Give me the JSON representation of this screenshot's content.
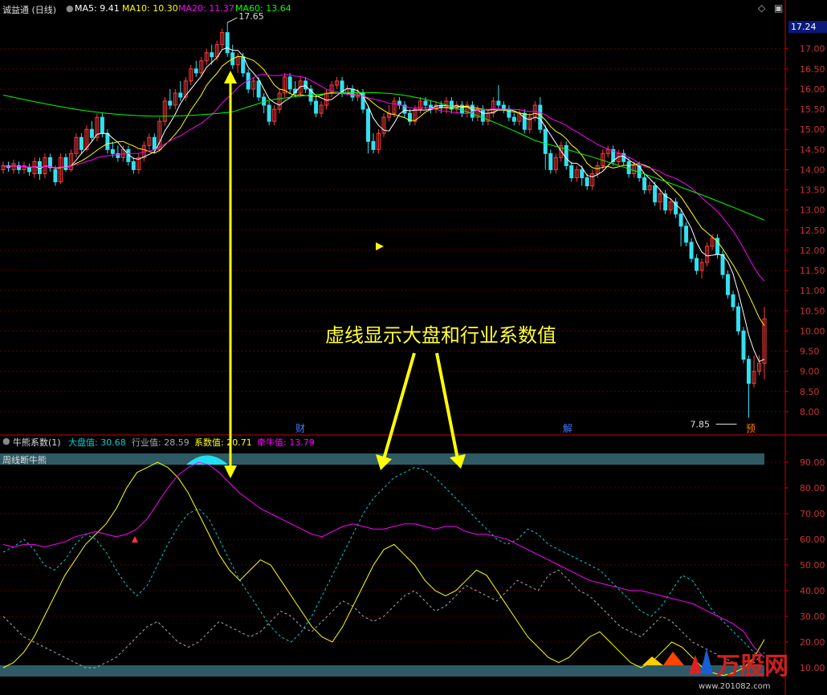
{
  "upper": {
    "stock_name": "诚益通 (日线)",
    "ma_legend": [
      {
        "label": "MA5: 9.41",
        "color": "#ffffff"
      },
      {
        "label": "MA10: 10.30",
        "color": "#ffff00"
      },
      {
        "label": "MA20: 11.37",
        "color": "#ff00ff"
      },
      {
        "label": "MA60: 13.64",
        "color": "#00ff00"
      }
    ],
    "current_price": "17.24",
    "high_label": "17.65",
    "low_label": "7.85",
    "event_markers": [
      "财",
      "解",
      "预"
    ]
  },
  "lower": {
    "indicator_name": "牛熊系数(1)",
    "legend": [
      {
        "label": "大盘值: 30.68",
        "color": "#00ced1"
      },
      {
        "label": "行业值: 28.59",
        "color": "#aaaaaa"
      },
      {
        "label": "系数值: 20.71",
        "color": "#ffff00"
      },
      {
        "label": "牵牛值: 13.79",
        "color": "#ff00ff"
      }
    ],
    "band_label": "周线断牛熊"
  },
  "annotation": "虚线显示大盘和行业系数值",
  "watermark": "万股网",
  "watermark_url": "www.201082.com",
  "chart_data": [
    {
      "type": "candlestick",
      "title": "诚益通 (日线)",
      "y_ticks": [
        "17.00",
        "16.50",
        "16.00",
        "15.50",
        "15.00",
        "14.50",
        "14.00",
        "13.50",
        "13.00",
        "12.50",
        "12.00",
        "11.50",
        "11.00",
        "10.50",
        "10.00",
        "9.50",
        "9.00",
        "8.50",
        "8.00"
      ],
      "ylim": [
        7.7,
        17.85
      ],
      "grid": true,
      "annotations": {
        "high": 17.65,
        "low": 7.85
      },
      "series": [
        {
          "name": "MA5",
          "color": "#ffffff"
        },
        {
          "name": "MA10",
          "color": "#ffff00"
        },
        {
          "name": "MA20",
          "color": "#ff00ff"
        },
        {
          "name": "MA60",
          "color": "#00ff00"
        }
      ],
      "candles": [
        [
          14.0,
          14.1,
          13.9,
          14.2
        ],
        [
          14.1,
          14.05,
          13.95,
          14.2
        ],
        [
          14.0,
          14.15,
          13.9,
          14.25
        ],
        [
          14.1,
          14.0,
          13.9,
          14.2
        ],
        [
          14.0,
          14.1,
          13.9,
          14.2
        ],
        [
          14.05,
          13.95,
          13.85,
          14.15
        ],
        [
          13.9,
          14.2,
          13.8,
          14.3
        ],
        [
          14.2,
          13.9,
          13.75,
          14.3
        ],
        [
          13.9,
          14.3,
          13.8,
          14.4
        ],
        [
          14.3,
          14.05,
          13.95,
          14.4
        ],
        [
          14.0,
          13.7,
          13.6,
          14.1
        ],
        [
          13.7,
          14.3,
          13.65,
          14.4
        ],
        [
          14.3,
          14.0,
          13.95,
          14.4
        ],
        [
          14.0,
          14.4,
          13.95,
          14.5
        ],
        [
          14.4,
          14.8,
          14.3,
          14.9
        ],
        [
          14.8,
          14.5,
          14.4,
          14.9
        ],
        [
          14.5,
          15.0,
          14.45,
          15.1
        ],
        [
          15.0,
          14.8,
          14.7,
          15.2
        ],
        [
          14.8,
          15.3,
          14.7,
          15.4
        ],
        [
          15.3,
          14.9,
          14.8,
          15.4
        ],
        [
          14.9,
          14.5,
          14.4,
          15.0
        ],
        [
          14.5,
          14.4,
          14.3,
          14.7
        ],
        [
          14.4,
          14.3,
          14.2,
          14.6
        ],
        [
          14.3,
          14.5,
          14.2,
          14.6
        ],
        [
          14.5,
          14.2,
          14.1,
          14.6
        ],
        [
          14.2,
          14.0,
          13.9,
          14.3
        ],
        [
          14.0,
          14.3,
          13.9,
          14.4
        ],
        [
          14.3,
          14.6,
          14.2,
          14.7
        ],
        [
          14.6,
          14.8,
          14.5,
          14.9
        ],
        [
          14.8,
          14.5,
          14.4,
          14.9
        ],
        [
          14.5,
          15.2,
          14.45,
          15.3
        ],
        [
          15.2,
          15.7,
          15.1,
          15.8
        ],
        [
          15.7,
          15.6,
          15.5,
          16.0
        ],
        [
          15.6,
          15.9,
          15.5,
          16.0
        ],
        [
          15.9,
          15.8,
          15.7,
          16.2
        ],
        [
          15.8,
          16.2,
          15.7,
          16.3
        ],
        [
          16.2,
          16.5,
          16.1,
          16.6
        ],
        [
          16.5,
          16.4,
          16.3,
          16.7
        ],
        [
          16.4,
          16.7,
          16.3,
          16.8
        ],
        [
          16.7,
          16.9,
          16.6,
          17.0
        ],
        [
          16.9,
          16.8,
          16.6,
          17.1
        ],
        [
          16.8,
          17.1,
          16.7,
          17.2
        ],
        [
          17.1,
          17.4,
          17.0,
          17.5
        ],
        [
          17.4,
          16.9,
          16.8,
          17.65
        ],
        [
          16.9,
          16.6,
          16.5,
          17.1
        ],
        [
          16.6,
          16.8,
          16.4,
          16.9
        ],
        [
          16.8,
          16.4,
          16.3,
          16.9
        ],
        [
          16.4,
          16.0,
          15.9,
          16.5
        ],
        [
          16.0,
          16.2,
          15.8,
          16.3
        ],
        [
          16.2,
          15.8,
          15.7,
          16.3
        ],
        [
          15.8,
          15.6,
          15.4,
          15.9
        ],
        [
          15.6,
          15.2,
          15.1,
          15.7
        ],
        [
          15.2,
          15.5,
          15.1,
          15.6
        ],
        [
          15.5,
          15.9,
          15.4,
          16.0
        ],
        [
          15.9,
          16.3,
          15.8,
          16.4
        ],
        [
          16.3,
          16.0,
          15.9,
          16.4
        ],
        [
          16.0,
          15.9,
          15.8,
          16.2
        ],
        [
          15.9,
          16.2,
          15.8,
          16.3
        ],
        [
          16.2,
          16.0,
          15.9,
          16.3
        ],
        [
          16.0,
          15.7,
          15.6,
          16.1
        ],
        [
          15.7,
          15.4,
          15.3,
          15.8
        ],
        [
          15.4,
          15.6,
          15.3,
          15.7
        ],
        [
          15.6,
          15.9,
          15.5,
          16.0
        ],
        [
          15.9,
          16.1,
          15.8,
          16.2
        ],
        [
          16.1,
          16.2,
          16.0,
          16.3
        ],
        [
          16.2,
          15.9,
          15.8,
          16.3
        ],
        [
          15.9,
          16.0,
          15.85,
          16.1
        ],
        [
          16.0,
          15.8,
          15.7,
          16.1
        ],
        [
          15.8,
          15.9,
          15.7,
          16.0
        ],
        [
          15.9,
          15.5,
          15.4,
          16.0
        ],
        [
          15.5,
          14.7,
          14.4,
          15.6
        ],
        [
          14.7,
          14.5,
          14.4,
          14.9
        ],
        [
          14.5,
          14.9,
          14.4,
          15.0
        ],
        [
          14.9,
          15.3,
          14.8,
          15.4
        ],
        [
          15.3,
          15.4,
          15.2,
          15.6
        ],
        [
          15.4,
          15.7,
          15.3,
          15.8
        ],
        [
          15.7,
          15.6,
          15.5,
          15.8
        ],
        [
          15.6,
          15.4,
          15.3,
          15.7
        ],
        [
          15.4,
          15.2,
          15.1,
          15.5
        ],
        [
          15.2,
          15.5,
          15.1,
          15.6
        ],
        [
          15.5,
          15.7,
          15.4,
          15.8
        ],
        [
          15.7,
          15.6,
          15.5,
          15.8
        ],
        [
          15.6,
          15.5,
          15.4,
          15.7
        ],
        [
          15.5,
          15.6,
          15.4,
          15.7
        ],
        [
          15.6,
          15.55,
          15.4,
          15.7
        ],
        [
          15.55,
          15.7,
          15.4,
          15.8
        ],
        [
          15.7,
          15.5,
          15.4,
          15.8
        ],
        [
          15.5,
          15.6,
          15.4,
          15.7
        ],
        [
          15.6,
          15.4,
          15.3,
          15.7
        ],
        [
          15.4,
          15.6,
          15.3,
          15.7
        ],
        [
          15.6,
          15.3,
          15.2,
          15.7
        ],
        [
          15.3,
          15.5,
          15.2,
          15.6
        ],
        [
          15.5,
          15.2,
          15.1,
          15.6
        ],
        [
          15.2,
          15.4,
          15.1,
          15.5
        ],
        [
          15.4,
          15.7,
          15.3,
          15.8
        ],
        [
          15.7,
          15.6,
          15.5,
          16.1
        ],
        [
          15.6,
          15.5,
          15.4,
          15.7
        ],
        [
          15.5,
          15.3,
          15.2,
          15.6
        ],
        [
          15.3,
          15.2,
          15.1,
          15.4
        ],
        [
          15.2,
          15.4,
          15.1,
          15.5
        ],
        [
          15.4,
          15.0,
          14.9,
          15.5
        ],
        [
          15.0,
          15.3,
          14.9,
          15.4
        ],
        [
          15.3,
          15.6,
          15.2,
          15.7
        ],
        [
          15.6,
          15.0,
          14.9,
          15.8
        ],
        [
          15.0,
          14.4,
          14.0,
          15.1
        ],
        [
          14.4,
          14.0,
          13.9,
          14.5
        ],
        [
          14.0,
          14.3,
          13.9,
          14.4
        ],
        [
          14.3,
          14.6,
          14.2,
          14.7
        ],
        [
          14.6,
          14.1,
          14.0,
          14.7
        ],
        [
          14.1,
          13.8,
          13.7,
          14.2
        ],
        [
          13.8,
          14.0,
          13.7,
          14.1
        ],
        [
          14.0,
          13.8,
          13.6,
          14.1
        ],
        [
          13.8,
          13.6,
          13.5,
          13.9
        ],
        [
          13.6,
          13.9,
          13.5,
          14.0
        ],
        [
          13.9,
          14.1,
          13.8,
          14.2
        ],
        [
          14.1,
          14.4,
          14.0,
          14.5
        ],
        [
          14.4,
          14.5,
          14.3,
          14.6
        ],
        [
          14.5,
          14.2,
          14.1,
          14.6
        ],
        [
          14.2,
          14.4,
          14.1,
          14.5
        ],
        [
          14.4,
          14.2,
          14.1,
          14.5
        ],
        [
          14.2,
          13.9,
          13.8,
          14.3
        ],
        [
          13.9,
          14.1,
          13.8,
          14.2
        ],
        [
          14.1,
          13.8,
          13.7,
          14.2
        ],
        [
          13.8,
          13.5,
          13.4,
          13.9
        ],
        [
          13.5,
          13.6,
          13.4,
          13.7
        ],
        [
          13.6,
          13.2,
          13.1,
          13.7
        ],
        [
          13.2,
          13.4,
          13.0,
          13.5
        ],
        [
          13.4,
          13.0,
          12.9,
          13.5
        ],
        [
          13.0,
          13.2,
          12.9,
          13.3
        ],
        [
          13.2,
          12.9,
          12.8,
          13.3
        ],
        [
          12.9,
          12.6,
          12.1,
          13.0
        ],
        [
          12.6,
          12.2,
          12.1,
          12.7
        ],
        [
          12.2,
          11.8,
          11.7,
          12.3
        ],
        [
          11.8,
          11.5,
          11.4,
          11.9
        ],
        [
          11.5,
          11.7,
          11.3,
          11.8
        ],
        [
          11.7,
          12.1,
          11.6,
          12.2
        ],
        [
          12.1,
          12.3,
          12.0,
          12.4
        ],
        [
          12.3,
          11.9,
          11.8,
          12.4
        ],
        [
          11.9,
          11.4,
          11.3,
          12.0
        ],
        [
          11.4,
          10.9,
          10.8,
          11.5
        ],
        [
          10.9,
          10.6,
          10.5,
          11.0
        ],
        [
          10.6,
          10.0,
          9.9,
          10.7
        ],
        [
          10.0,
          9.3,
          9.2,
          10.1
        ],
        [
          9.3,
          8.7,
          7.85,
          9.4
        ],
        [
          8.7,
          9.0,
          8.6,
          9.4
        ],
        [
          9.0,
          9.2,
          8.9,
          9.4
        ],
        [
          9.2,
          10.3,
          8.8,
          10.6
        ]
      ]
    },
    {
      "type": "line",
      "title": "牛熊系数(1)",
      "y_ticks": [
        "90.00",
        "80.00",
        "70.00",
        "60.00",
        "50.00",
        "40.00",
        "30.00",
        "20.00",
        "10.00"
      ],
      "ylim": [
        5,
        95
      ],
      "grid": true,
      "series": [
        {
          "name": "大盘值",
          "color": "#00ced1",
          "style": "dashed",
          "values": [
            55,
            57,
            60,
            56,
            50,
            48,
            52,
            58,
            62,
            60,
            55,
            48,
            42,
            38,
            42,
            50,
            58,
            65,
            70,
            72,
            68,
            60,
            52,
            44,
            38,
            32,
            26,
            22,
            20,
            24,
            30,
            38,
            46,
            54,
            62,
            70,
            76,
            80,
            84,
            86,
            88,
            87,
            84,
            80,
            76,
            72,
            68,
            64,
            60,
            58,
            60,
            64,
            62,
            58,
            56,
            54,
            52,
            50,
            48,
            44,
            40,
            36,
            32,
            30,
            34,
            40,
            46,
            44,
            38,
            32,
            28,
            24,
            20,
            16,
            14
          ]
        },
        {
          "name": "行业值",
          "color": "#aaaaaa",
          "style": "dashed",
          "values": [
            30,
            26,
            22,
            20,
            18,
            16,
            14,
            12,
            10,
            10,
            12,
            14,
            18,
            22,
            26,
            28,
            24,
            20,
            18,
            20,
            24,
            28,
            26,
            24,
            22,
            24,
            28,
            32,
            30,
            26,
            24,
            28,
            32,
            36,
            34,
            30,
            28,
            30,
            34,
            38,
            40,
            36,
            32,
            34,
            38,
            42,
            40,
            38,
            36,
            40,
            44,
            42,
            40,
            46,
            48,
            44,
            40,
            38,
            34,
            30,
            26,
            24,
            22,
            26,
            30,
            28,
            24,
            20,
            18,
            16,
            14,
            12,
            10,
            12,
            16
          ]
        },
        {
          "name": "系数值",
          "color": "#ffff00",
          "style": "solid",
          "values": [
            10,
            12,
            16,
            22,
            30,
            38,
            46,
            52,
            58,
            62,
            66,
            72,
            80,
            86,
            88,
            90,
            88,
            84,
            78,
            70,
            62,
            54,
            48,
            44,
            48,
            52,
            50,
            44,
            38,
            32,
            26,
            22,
            20,
            26,
            34,
            42,
            50,
            56,
            58,
            54,
            50,
            44,
            40,
            38,
            40,
            44,
            48,
            46,
            40,
            34,
            28,
            22,
            18,
            14,
            12,
            14,
            18,
            22,
            24,
            20,
            16,
            12,
            10,
            12,
            16,
            20,
            18,
            14,
            10,
            8,
            7,
            8,
            10,
            14,
            21
          ]
        },
        {
          "name": "牵牛值",
          "color": "#ff00ff",
          "style": "solid",
          "values": [
            58,
            57,
            58,
            58,
            57,
            58,
            59,
            61,
            62,
            63,
            62,
            61,
            62,
            64,
            68,
            74,
            80,
            85,
            88,
            90,
            89,
            86,
            82,
            78,
            75,
            72,
            70,
            68,
            66,
            64,
            62,
            61,
            63,
            65,
            66,
            65,
            64,
            64,
            65,
            66,
            66,
            65,
            64,
            65,
            65,
            63,
            62,
            62,
            61,
            60,
            58,
            56,
            54,
            52,
            50,
            48,
            46,
            44,
            43,
            42,
            41,
            40,
            40,
            39,
            38,
            37,
            36,
            35,
            33,
            31,
            29,
            27,
            24,
            18,
            14
          ]
        }
      ]
    }
  ]
}
